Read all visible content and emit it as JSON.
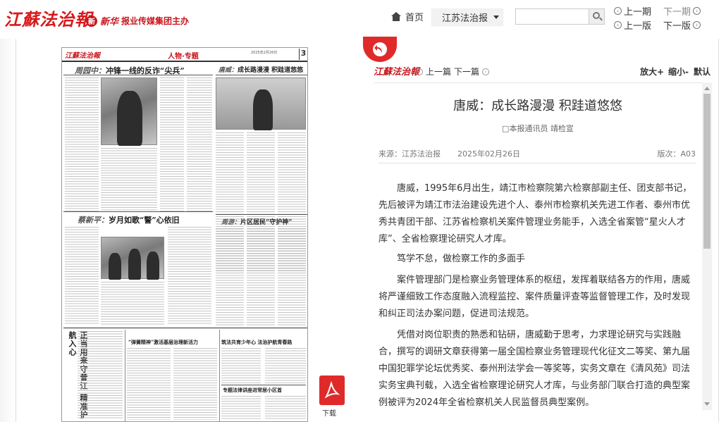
{
  "header": {
    "logo": "江蘇法治報",
    "group_mark": "新",
    "group_brush": "新华",
    "group_text": "报业传媒集团主办",
    "home_label": "首页",
    "paper_select": "江苏法治报",
    "search": {
      "value": "",
      "placeholder": ""
    },
    "prev_issue": "上一期",
    "next_issue": "下一期",
    "prev_page": "上一版",
    "next_page": "下一版"
  },
  "newspaper": {
    "logo": "江蘇法治報",
    "section": "人物·专题",
    "date": "2025年2月26日",
    "page_number": "3",
    "story1_lead": "周园中：",
    "story1_title": "冲锋一线的反诈“尖兵”",
    "story2_lead": "唐威：",
    "story2_title": "成长路漫漫 积跬道悠悠",
    "story3_lead": "蔡新平：",
    "story3_title": "岁月如歌“警”心依旧",
    "story4_lead": "周游：",
    "story4_title": "片区居民“守护神”",
    "vertical_title": "正当用来守昔江 精准护航入心",
    "bottom1_title": "“弹簧精神”激活基层治理新活力",
    "bottom2_title": "筑法共育少年心 法治护航青春路",
    "bottom3_title": "专题法律讲座进常居小区首",
    "download_label": "下载"
  },
  "reader": {
    "logo": "江蘇法治報",
    "prev_article": "上一篇",
    "next_article": "下一篇",
    "zoom_in": "放大+",
    "zoom_out": "缩小-",
    "reset": "默认"
  },
  "article": {
    "title": "唐威：成长路漫漫 积跬道悠悠",
    "byline": "□本报通讯员 靖检宣",
    "source": "来源：江苏法治报",
    "date": "2025年02月26日",
    "page": "版次：A03",
    "paragraphs": [
      "唐威，1995年6月出生，靖江市检察院第六检察部副主任、团支部书记，先后被评为靖江市法治建设先进个人、泰州市检察机关先进工作者、泰州市优秀共青团干部、江苏省检察机关案件管理业务能手，入选全省案管“星火人才库”、全省检察理论研究人才库。",
      "笃学不怠，做检察工作的多面手",
      "案件管理部门是检察业务管理体系的枢纽，发挥着联结各方的作用，唐威将严谨细致工作态度融入流程监控、案件质量评查等监督管理工作，及时发现和纠正司法办案问题，促进司法规范。",
      "凭借对岗位职责的熟悉和钻研，唐威勤于思考，力求理论研究与实践融合，撰写的调研文章获得第一届全国检察业务管理现代化征文二等奖、第九届中国犯罪学论坛优秀奖、泰州刑法学会一等奖等，实务文章在《清风苑》司法实务宝典刊载，入选全省检察理论研究人才库，与业务部门联合打造的典型案例被评为2024年全省检察机关人民监督员典型案例。"
    ]
  },
  "colors": {
    "brand_red": "#c8161d",
    "button_red": "#e02a2a"
  },
  "icons": [
    "home-icon",
    "chevron-down-icon",
    "search-icon",
    "circle-left-icon",
    "circle-right-icon",
    "back-arrow-icon",
    "pdf-icon"
  ]
}
